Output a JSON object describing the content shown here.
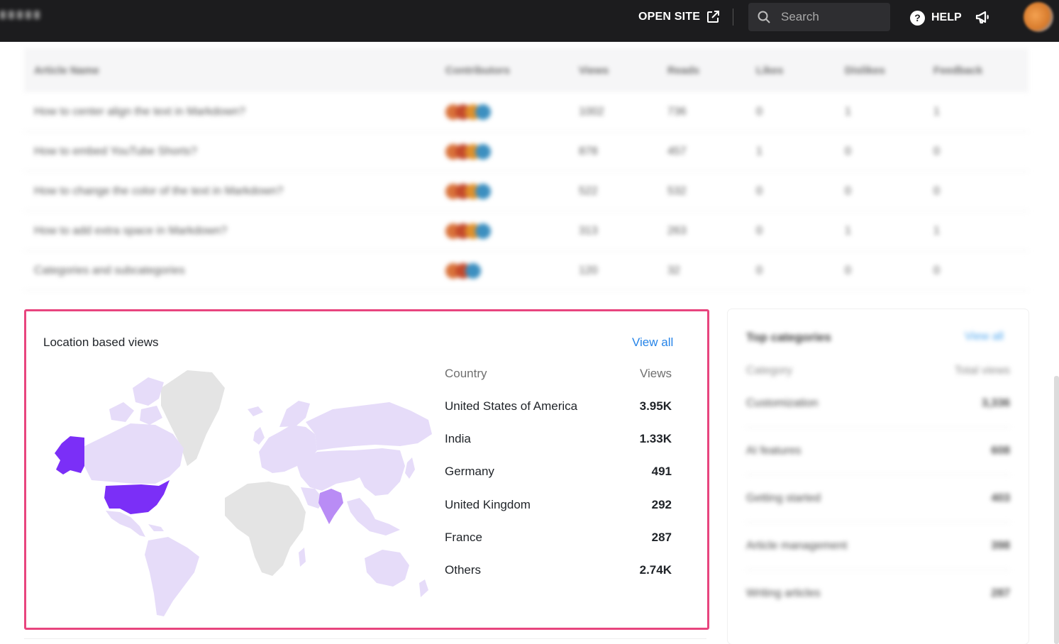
{
  "topbar": {
    "open_site_label": "OPEN SITE",
    "search_placeholder": "Search",
    "help_label": "HELP",
    "help_glyph": "?",
    "icons": [
      "external-link-icon",
      "search-icon",
      "help-circle-icon",
      "megaphone-icon"
    ]
  },
  "articles_table": {
    "blurred": true,
    "headers": [
      "Article Name",
      "Contributors",
      "Views",
      "Reads",
      "Likes",
      "Dislikes",
      "Feedback"
    ],
    "rows": [
      [
        "How to center align the text in Markdown?",
        "",
        "1002",
        "736",
        "0",
        "1",
        "1"
      ],
      [
        "How to embed YouTube Shorts?",
        "",
        "878",
        "457",
        "1",
        "0",
        "0"
      ],
      [
        "How to change the color of the text in Markdown?",
        "",
        "522",
        "532",
        "0",
        "0",
        "0"
      ],
      [
        "How to add extra space in Markdown?",
        "",
        "313",
        "263",
        "0",
        "1",
        "1"
      ],
      [
        "Categories and subcategories",
        "",
        "120",
        "32",
        "0",
        "0",
        "0"
      ]
    ]
  },
  "location_views": {
    "title": "Location based views",
    "view_all_label": "View all",
    "col_country": "Country",
    "col_views": "Views",
    "rows": [
      {
        "country": "United States of America",
        "views": "3.95K"
      },
      {
        "country": "India",
        "views": "1.33K"
      },
      {
        "country": "Germany",
        "views": "491"
      },
      {
        "country": "United Kingdom",
        "views": "292"
      },
      {
        "country": "France",
        "views": "287"
      },
      {
        "country": "Others",
        "views": "2.74K"
      }
    ],
    "map_colors": {
      "high": "#7b2ff7",
      "medium": "#b98cf5",
      "low": "#e6dcf9",
      "none": "#e4e4e4"
    }
  },
  "top_categories": {
    "blurred": true,
    "title": "Top categories",
    "view_all_label": "View all",
    "col_category": "Category",
    "col_views": "Total views",
    "rows": [
      {
        "name": "Customization",
        "views": "3,336"
      },
      {
        "name": "AI features",
        "views": "608"
      },
      {
        "name": "Getting started",
        "views": "403"
      },
      {
        "name": "Article management",
        "views": "398"
      },
      {
        "name": "Writing articles",
        "views": "287"
      }
    ]
  }
}
